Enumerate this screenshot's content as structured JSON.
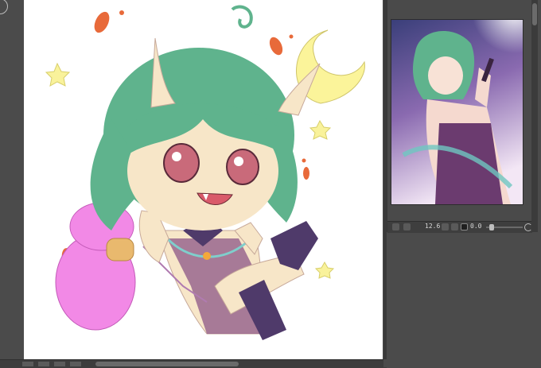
{
  "canvas": {
    "illustration": "chibi-oni-girl-sketch"
  },
  "navigator": {
    "preview": "full-illustration-preview",
    "zoom": "12.6",
    "angle": "0.0"
  },
  "colors": {
    "workspace": "#4b4b4b",
    "canvas": "#ffffff",
    "hair": "#5fb38d",
    "skin": "#f7e6c8",
    "moon": "#fbf49a",
    "gourd": "#f289e6",
    "outfit": "#7a4a7a",
    "sock": "#4f3a6a"
  },
  "icons": {
    "corner": "brush-size-icon",
    "rotate": "rotate-icon",
    "flip": "flip-icon",
    "fit": "fit-screen-icon"
  }
}
